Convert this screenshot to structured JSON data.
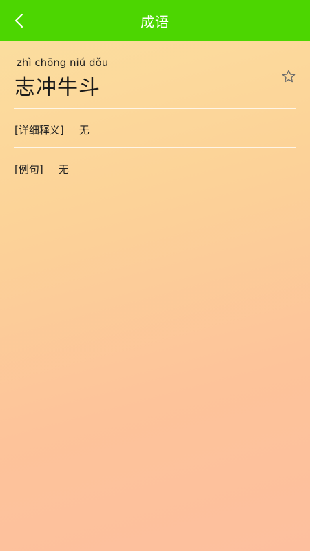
{
  "header": {
    "title": "成语",
    "back_icon": "chevron-left-icon"
  },
  "idiom": {
    "pinyin": "zhì chōng niú dǒu",
    "text": "志冲牛斗",
    "favorite_icon": "star-outline-icon"
  },
  "details": [
    {
      "label": "[详细释义]",
      "value": "无"
    },
    {
      "label": "[例句]",
      "value": "无"
    }
  ],
  "colors": {
    "header_bg": "#4cd601",
    "header_text": "#ffffff"
  }
}
